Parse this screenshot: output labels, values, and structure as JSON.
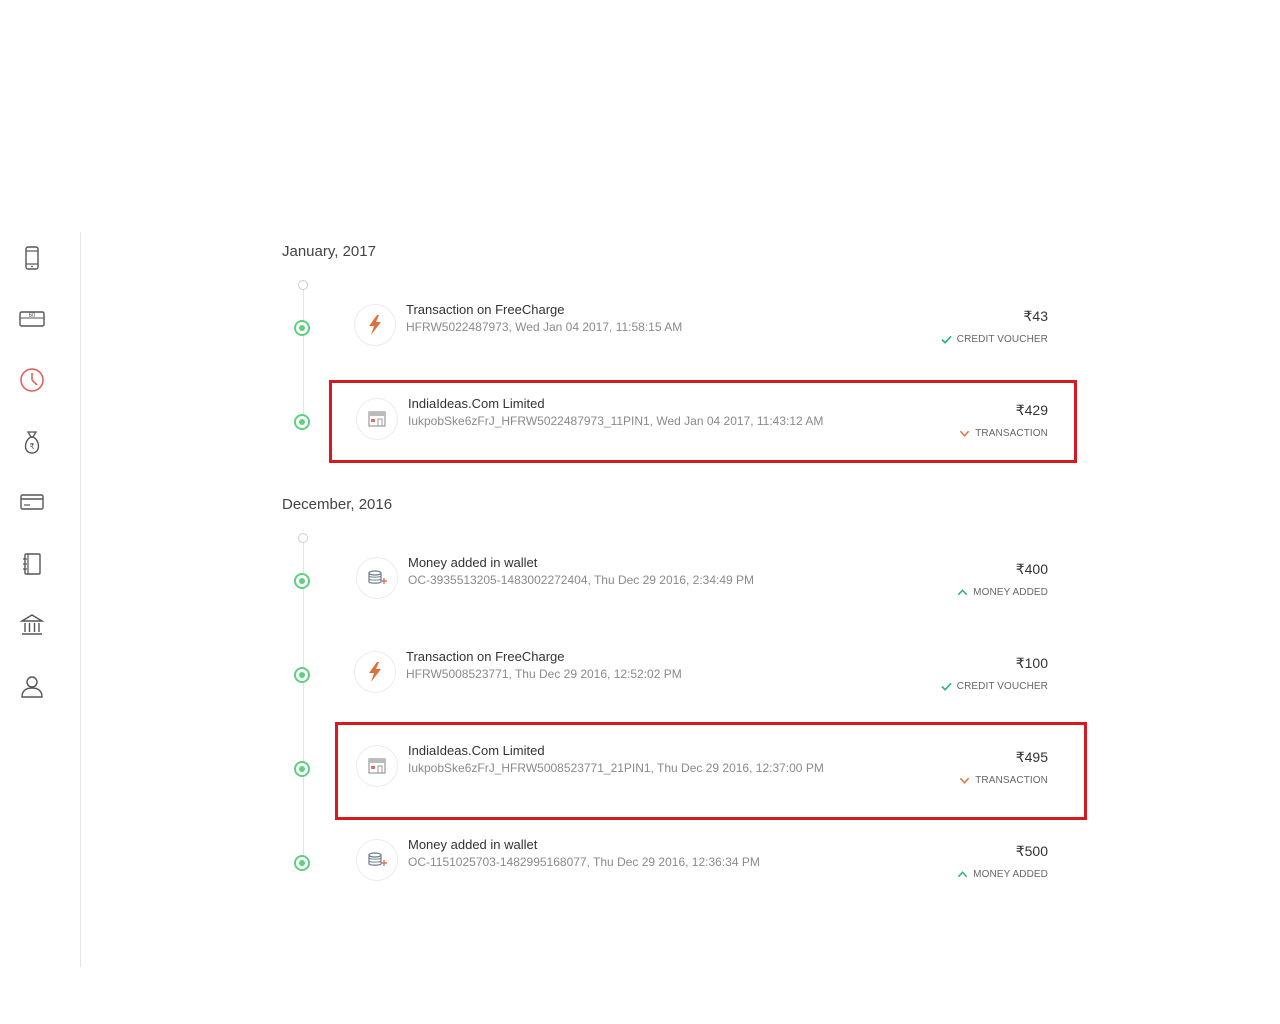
{
  "sidebar": {
    "items": [
      {
        "icon": "mobile-icon"
      },
      {
        "icon": "gift-card-icon",
        "text": "60"
      },
      {
        "icon": "clock-icon",
        "active_color": "#e05a4f"
      },
      {
        "icon": "money-bag-icon"
      },
      {
        "icon": "card-icon"
      },
      {
        "icon": "notebook-icon"
      },
      {
        "icon": "bank-icon"
      },
      {
        "icon": "user-icon"
      }
    ]
  },
  "groups": [
    {
      "month": "January, 2017",
      "entries": [
        {
          "icon": "freecharge-icon",
          "title": "Transaction on FreeCharge",
          "subtitle": "HFRW5022487973, Wed Jan 04 2017, 11:58:15 AM",
          "amount": "₹43",
          "tag": "CREDIT VOUCHER",
          "tag_icon": "check-icon"
        },
        {
          "icon": "store-icon",
          "title": "IndiaIdeas.Com Limited",
          "subtitle": "IukpobSke6zFrJ_HFRW5022487973_11PIN1, Wed Jan 04 2017, 11:43:12 AM",
          "amount": "₹429",
          "tag": "TRANSACTION",
          "tag_icon": "chevron-down-icon",
          "highlighted": true
        }
      ]
    },
    {
      "month": "December, 2016",
      "entries": [
        {
          "icon": "wallet-add-icon",
          "title": "Money added in wallet",
          "subtitle": "OC-3935513205-1483002272404, Thu Dec 29 2016, 2:34:49 PM",
          "amount": "₹400",
          "tag": "MONEY ADDED",
          "tag_icon": "chevron-up-icon"
        },
        {
          "icon": "freecharge-icon",
          "title": "Transaction on FreeCharge",
          "subtitle": "HFRW5008523771, Thu Dec 29 2016, 12:52:02 PM",
          "amount": "₹100",
          "tag": "CREDIT VOUCHER",
          "tag_icon": "check-icon"
        },
        {
          "icon": "store-icon",
          "title": "IndiaIdeas.Com Limited",
          "subtitle": "IukpobSke6zFrJ_HFRW5008523771_21PIN1, Thu Dec 29 2016, 12:37:00 PM",
          "amount": "₹495",
          "tag": "TRANSACTION",
          "tag_icon": "chevron-down-icon",
          "highlighted": true
        },
        {
          "icon": "wallet-add-icon",
          "title": "Money added in wallet",
          "subtitle": "OC-1151025703-1482995168077, Thu Dec 29 2016, 12:36:34 PM",
          "amount": "₹500",
          "tag": "MONEY ADDED",
          "tag_icon": "chevron-up-icon"
        }
      ]
    }
  ],
  "colors": {
    "node_green": "#5fcf80",
    "highlight_red": "#d71920",
    "credit_green": "#2bb673",
    "transaction_orange": "#e0703b",
    "money_added_green": "#2bb673"
  }
}
